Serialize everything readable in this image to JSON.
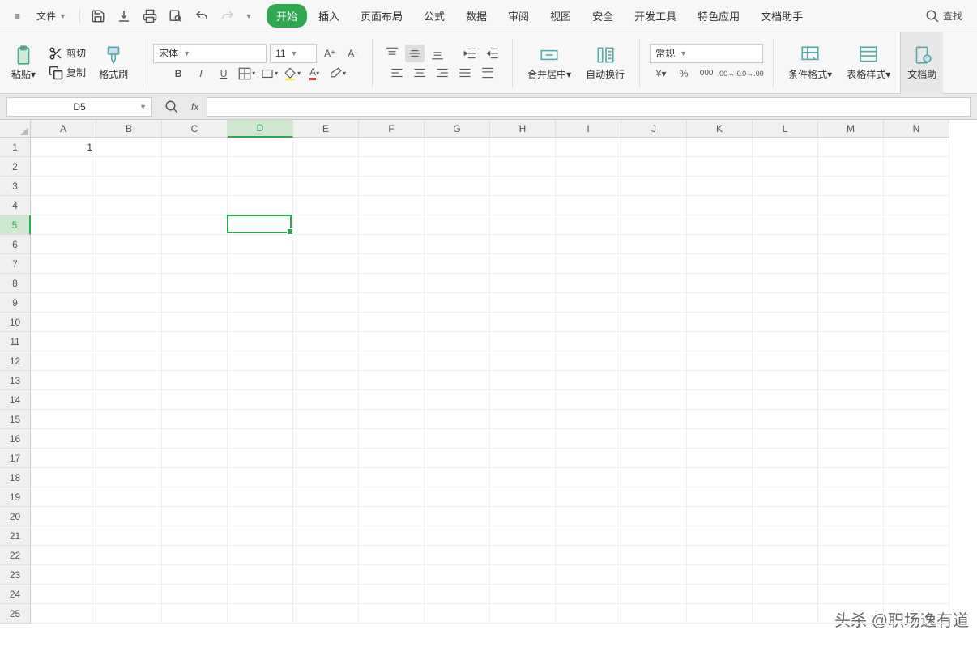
{
  "menu": {
    "file": "文件"
  },
  "tabs": [
    "开始",
    "插入",
    "页面布局",
    "公式",
    "数据",
    "审阅",
    "视图",
    "安全",
    "开发工具",
    "特色应用",
    "文档助手"
  ],
  "active_tab": 0,
  "find": "查找",
  "clipboard": {
    "paste": "粘贴",
    "cut": "剪切",
    "copy": "复制",
    "format_painter": "格式刷"
  },
  "font": {
    "name": "宋体",
    "size": "11"
  },
  "merge": "合并居中",
  "wrap": "自动换行",
  "num_format": "常规",
  "cond_format": "条件格式",
  "table_style": "表格样式",
  "doc_help": "文档助",
  "namebox": "D5",
  "columns": [
    "A",
    "B",
    "C",
    "D",
    "E",
    "F",
    "G",
    "H",
    "I",
    "J",
    "K",
    "L",
    "M",
    "N"
  ],
  "rows": 25,
  "selected_cell": {
    "col": 3,
    "row": 4
  },
  "cells": {
    "A1": "1"
  },
  "watermark": "头杀 @职场逸有道"
}
